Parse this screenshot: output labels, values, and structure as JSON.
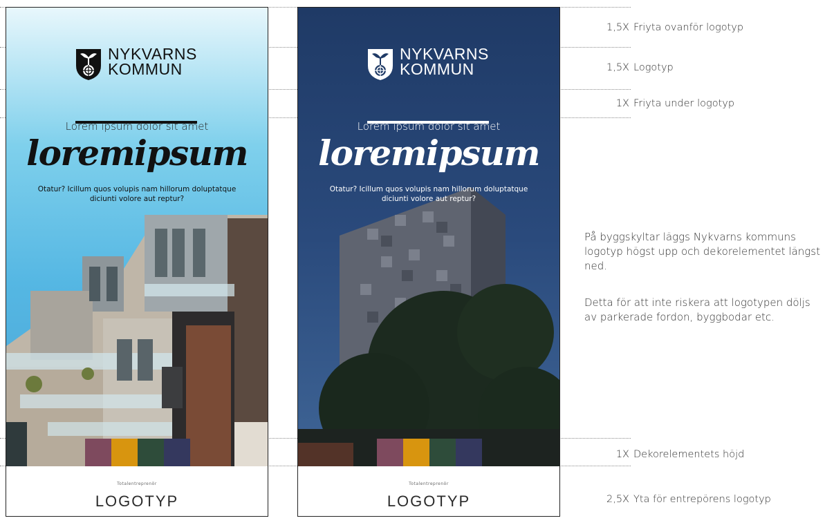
{
  "logo": {
    "line1": "NYKVARNS",
    "line2": "KOMMUN"
  },
  "sign": {
    "tagline": "Lorem ipsum dolor sit amet",
    "title": "loremipsum",
    "body": "Otatur? Icillum quos volupis nam hillorum doluptatque diciunti volore aut reptur?",
    "contractor_label": "Totalentreprenör",
    "contractor_logo": "LOGOTYP"
  },
  "decor_colors": [
    "#7e4a5e",
    "#d8950f",
    "#2e4c3a",
    "#34385e"
  ],
  "annotations": [
    {
      "mult": "1,5X",
      "label": "Friyta ovanför logotyp"
    },
    {
      "mult": "1,5X",
      "label": "Logotyp"
    },
    {
      "mult": "1X",
      "label": "Friyta under logotyp"
    },
    {
      "mult": "1X",
      "label": "Dekorelementets höjd"
    },
    {
      "mult": "2,5X",
      "label": "Yta för entrepörens logotyp"
    }
  ],
  "paragraphs": [
    "På byggskyltar läggs Nykvarns kommuns logotyp högst upp och dekorelementet längst ned.",
    "Detta för att inte riskera att logotypen döljs av parkerade fordon, byggbodar etc."
  ]
}
